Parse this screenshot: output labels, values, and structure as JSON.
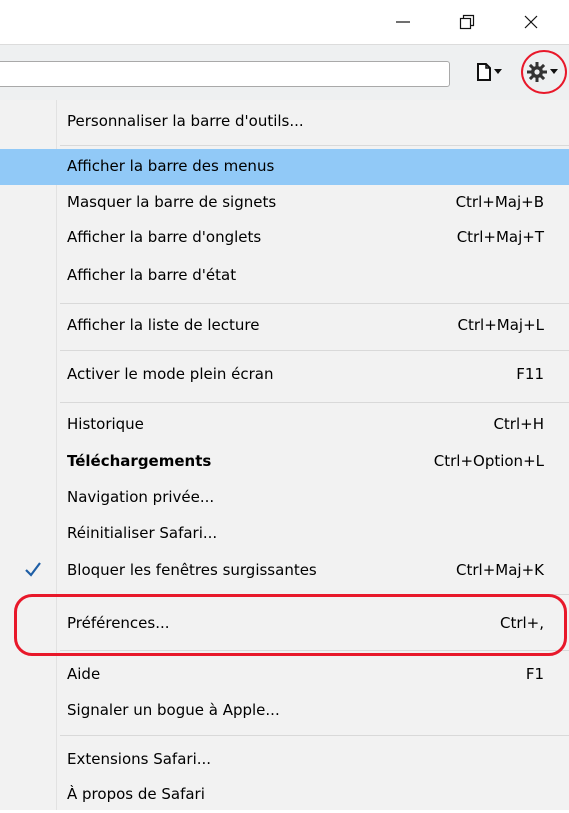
{
  "window_controls": {
    "minimize": "—",
    "maximize": "⧉",
    "close": "✕"
  },
  "toolbar": {
    "page_icon": "page-icon",
    "gear_icon": "gear-icon",
    "caret": "▾"
  },
  "menu": {
    "customize": "Personnaliser la barre d'outils...",
    "show_menubar": "Afficher la barre des menus",
    "hide_bookmarks": {
      "label": "Masquer la barre de signets",
      "shortcut": "Ctrl+Maj+B"
    },
    "show_tabbar": {
      "label": "Afficher la barre d'onglets",
      "shortcut": "Ctrl+Maj+T"
    },
    "show_statusbar": "Afficher la barre d'état",
    "show_readinglist": {
      "label": "Afficher la liste de lecture",
      "shortcut": "Ctrl+Maj+L"
    },
    "fullscreen": {
      "label": "Activer le mode plein écran",
      "shortcut": "F11"
    },
    "history": {
      "label": "Historique",
      "shortcut": "Ctrl+H"
    },
    "downloads": {
      "label": "Téléchargements",
      "shortcut": "Ctrl+Option+L"
    },
    "private": "Navigation privée...",
    "reset": "Réinitialiser Safari...",
    "block_popups": {
      "label": "Bloquer les fenêtres surgissantes",
      "shortcut": "Ctrl+Maj+K"
    },
    "preferences": {
      "label": "Préférences...",
      "shortcut": "Ctrl+,"
    },
    "help": {
      "label": "Aide",
      "shortcut": "F1"
    },
    "report_bug": "Signaler un bogue à Apple...",
    "extensions": "Extensions Safari...",
    "about": "À propos de Safari"
  },
  "colors": {
    "highlight": "#91c9f7",
    "annotation": "#e8182a",
    "menu_bg": "#f2f2f2"
  }
}
